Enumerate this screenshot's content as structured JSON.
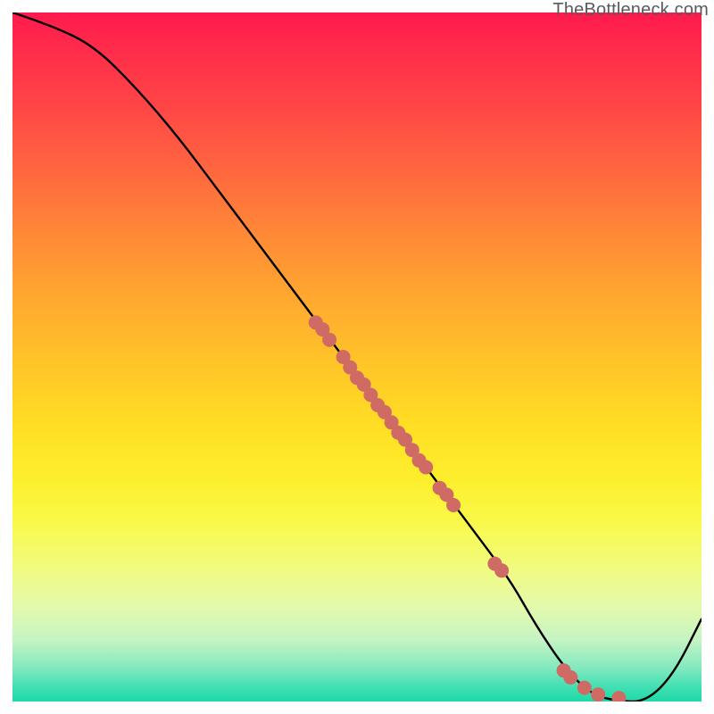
{
  "watermark": "TheBottleneck.com",
  "colors": {
    "curve_stroke": "#000000",
    "dot_fill": "#cf6a65",
    "dot_stroke": "#b85b56"
  },
  "chart_data": {
    "type": "line",
    "title": "",
    "xlabel": "",
    "ylabel": "",
    "xlim": [
      0,
      100
    ],
    "ylim": [
      0,
      100
    ],
    "grid": false,
    "legend": false,
    "series": [
      {
        "name": "bottleneck-curve",
        "x": [
          0,
          6,
          12,
          18,
          24,
          30,
          36,
          42,
          48,
          54,
          60,
          66,
          72,
          76,
          80,
          84,
          88,
          92,
          96,
          100
        ],
        "y": [
          100,
          98,
          95,
          89,
          82,
          74,
          66,
          58,
          50,
          42,
          34,
          26,
          18,
          11,
          5,
          1,
          0,
          0,
          4,
          12
        ]
      }
    ],
    "scatter": {
      "name": "marker-dots",
      "points": [
        {
          "x": 44,
          "y": 55
        },
        {
          "x": 45,
          "y": 54
        },
        {
          "x": 46,
          "y": 52.5
        },
        {
          "x": 48,
          "y": 50
        },
        {
          "x": 49,
          "y": 48.5
        },
        {
          "x": 50,
          "y": 47
        },
        {
          "x": 51,
          "y": 46
        },
        {
          "x": 52,
          "y": 44.5
        },
        {
          "x": 53,
          "y": 43
        },
        {
          "x": 54,
          "y": 42
        },
        {
          "x": 55,
          "y": 40.5
        },
        {
          "x": 56,
          "y": 39
        },
        {
          "x": 57,
          "y": 38
        },
        {
          "x": 58,
          "y": 36.5
        },
        {
          "x": 59,
          "y": 35
        },
        {
          "x": 60,
          "y": 34
        },
        {
          "x": 62,
          "y": 31
        },
        {
          "x": 63,
          "y": 30
        },
        {
          "x": 64,
          "y": 28.5
        },
        {
          "x": 70,
          "y": 20
        },
        {
          "x": 71,
          "y": 19
        },
        {
          "x": 80,
          "y": 4.5
        },
        {
          "x": 81,
          "y": 3.5
        },
        {
          "x": 83,
          "y": 2
        },
        {
          "x": 85,
          "y": 1
        },
        {
          "x": 88,
          "y": 0.5
        }
      ]
    }
  }
}
